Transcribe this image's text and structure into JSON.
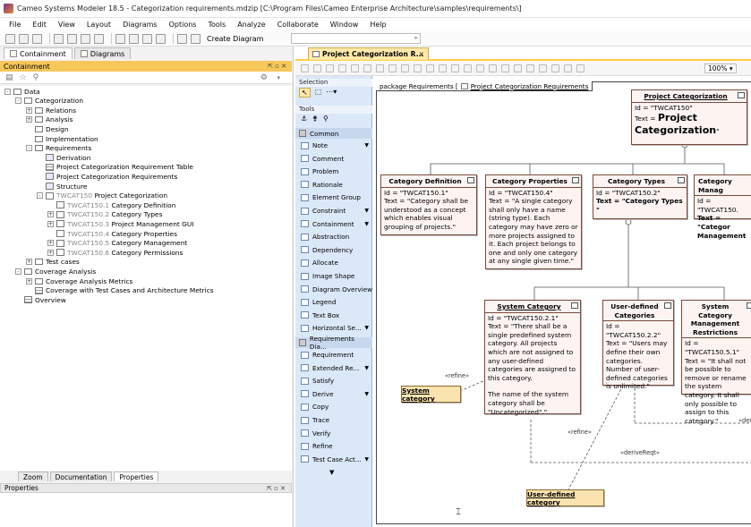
{
  "window": {
    "title": "Cameo Systems Modeler 18.5 - Categorization requirements.mdzip [C:\\Program Files\\Cameo Enterprise Architecture\\samples\\requirements\\]"
  },
  "menu": [
    "File",
    "Edit",
    "View",
    "Layout",
    "Diagrams",
    "Options",
    "Tools",
    "Analyze",
    "Collaborate",
    "Window",
    "Help"
  ],
  "toolbar": {
    "create_diagram": "Create Diagram"
  },
  "left": {
    "tabs": [
      "Containment",
      "Diagrams"
    ],
    "panel_title": "Containment",
    "tree": [
      {
        "label": "Data",
        "depth": 0,
        "expander": "-",
        "icon": "folder"
      },
      {
        "label": "Categorization",
        "depth": 1,
        "expander": "-",
        "icon": "folder"
      },
      {
        "label": "Relations",
        "depth": 2,
        "expander": "+",
        "icon": "folder"
      },
      {
        "label": "Analysis",
        "depth": 2,
        "expander": "+",
        "icon": "folder"
      },
      {
        "label": "Design",
        "depth": 2,
        "expander": "",
        "icon": "folder"
      },
      {
        "label": "Implementation",
        "depth": 2,
        "expander": "",
        "icon": "folder"
      },
      {
        "label": "Requirements",
        "depth": 2,
        "expander": "-",
        "icon": "folder"
      },
      {
        "label": "Derivation",
        "depth": 3,
        "expander": "",
        "icon": "diag"
      },
      {
        "label": "Project Categorization Requirement Table",
        "depth": 3,
        "expander": "",
        "icon": "table"
      },
      {
        "label": "Project Categorization Requirements",
        "depth": 3,
        "expander": "",
        "icon": "diag"
      },
      {
        "label": "Structure",
        "depth": 3,
        "expander": "",
        "icon": "diag"
      },
      {
        "label": "TWCAT150 Project Categorization",
        "depth": 3,
        "expander": "-",
        "icon": "req",
        "gray_prefix": "TWCAT150",
        "rest": " Project Categorization"
      },
      {
        "label": "TWCAT150.1 Category Definition",
        "depth": 4,
        "expander": "",
        "icon": "req",
        "gray_prefix": "TWCAT150.1",
        "rest": " Category Definition"
      },
      {
        "label": "TWCAT150.2 Category Types",
        "depth": 4,
        "expander": "+",
        "icon": "req",
        "gray_prefix": "TWCAT150.2",
        "rest": " Category Types"
      },
      {
        "label": "TWCAT150.3 Project Management GUI",
        "depth": 4,
        "expander": "+",
        "icon": "req",
        "gray_prefix": "TWCAT150.3",
        "rest": " Project Management GUI"
      },
      {
        "label": "TWCAT150.4 Category Properties",
        "depth": 4,
        "expander": "",
        "icon": "req",
        "gray_prefix": "TWCAT150.4",
        "rest": " Category Properties"
      },
      {
        "label": "TWCAT150.5 Category Management",
        "depth": 4,
        "expander": "+",
        "icon": "req",
        "gray_prefix": "TWCAT150.5",
        "rest": " Category Management"
      },
      {
        "label": "TWCAT150.6 Category Permissions",
        "depth": 4,
        "expander": "+",
        "icon": "req",
        "gray_prefix": "TWCAT150.6",
        "rest": " Category Permissions"
      },
      {
        "label": "Test cases",
        "depth": 2,
        "expander": "+",
        "icon": "folder"
      },
      {
        "label": "Coverage Analysis",
        "depth": 1,
        "expander": "-",
        "icon": "folder"
      },
      {
        "label": "Coverage Analysis Metrics",
        "depth": 2,
        "expander": "+",
        "icon": "folder"
      },
      {
        "label": "Coverage with Test Cases and Architecture Metrics",
        "depth": 2,
        "expander": "",
        "icon": "table"
      },
      {
        "label": "Overview",
        "depth": 1,
        "expander": "",
        "icon": "table"
      }
    ],
    "bottom_tabs": [
      "Zoom",
      "Documentation",
      "Properties"
    ],
    "properties_title": "Properties"
  },
  "diagram": {
    "tab_label": "Project Categorization R...",
    "tab_close": "×",
    "zoom": "100%",
    "frame_label": "package  Requirements [",
    "frame_diagram": "Project Categorization Requirements"
  },
  "palette": {
    "selection_header": "Selection",
    "tools_header": "Tools",
    "common_header": "Common",
    "common_items": [
      {
        "label": "Note",
        "dd": true
      },
      {
        "label": "Comment",
        "dd": false
      },
      {
        "label": "Problem",
        "dd": false
      },
      {
        "label": "Rationale",
        "dd": false
      },
      {
        "label": "Element Group",
        "dd": false
      },
      {
        "label": "Constraint",
        "dd": true
      },
      {
        "label": "Containment",
        "dd": true
      },
      {
        "label": "Abstraction",
        "dd": false
      },
      {
        "label": "Dependency",
        "dd": false
      },
      {
        "label": "Allocate",
        "dd": false
      },
      {
        "label": "Image Shape",
        "dd": false
      },
      {
        "label": "Diagram Overview",
        "dd": false
      },
      {
        "label": "Legend",
        "dd": false
      },
      {
        "label": "Text Box",
        "dd": false
      },
      {
        "label": "Horizontal Se...",
        "dd": true
      }
    ],
    "req_header": "Requirements Dia...",
    "req_items": [
      {
        "label": "Requirement",
        "dd": false
      },
      {
        "label": "Extended Re...",
        "dd": true
      },
      {
        "label": "Satisfy",
        "dd": false
      },
      {
        "label": "Derive",
        "dd": true
      },
      {
        "label": "Copy",
        "dd": false
      },
      {
        "label": "Trace",
        "dd": false
      },
      {
        "label": "Verify",
        "dd": false
      },
      {
        "label": "Refine",
        "dd": false
      },
      {
        "label": "Test Case Act...",
        "dd": true
      }
    ]
  },
  "requirements": {
    "root": {
      "name": "Project Categorization",
      "id": "Id = \"TWCAT150\"",
      "text_prefix": "Text = ",
      "text_big": "Project Categorization",
      "text_suffix": "\""
    },
    "def": {
      "name": "Category Definition",
      "id": "Id = \"TWCAT150.1\"",
      "text": "Text = \"Category shall be understood as a concept which enables visual grouping of projects.\""
    },
    "props": {
      "name": "Category Properties",
      "id": "Id = \"TWCAT150.4\"",
      "text": "Text = \"A single category shall only have a name (string type). Each category may have zero or more projects assigned to it. Each project belongs to one and only one category at any single given time.\""
    },
    "types": {
      "name": "Category Types",
      "id": "Id = \"TWCAT150.2\"",
      "text": "Text = \"Category Types \""
    },
    "mgmt": {
      "name": "Category Manag",
      "id": "Id = \"TWCAT150.",
      "text": "Text = \"Categor Management"
    },
    "system": {
      "name": "System Category",
      "id": "Id = \"TWCAT150.2.1\"",
      "text": "Text = \"There shall be a single predefined system category. All projects which are not assigned to any user-defined categories are assigned to this category.",
      "text2": "The name of the system category shall be \"Uncategorized\".\""
    },
    "user": {
      "name": "User-defined Categories",
      "id": "Id = \"TWCAT150.2.2\"",
      "text": "Text = \"Users may define their own categories. Number of user-defined categories is unlimited.\""
    },
    "sysmgmt": {
      "name": "System Category Management Restrictions",
      "id": "Id = \"TWCAT150.5.1\"",
      "text": "Text = \"It shall not be possible to remove or rename the system category. It shall only possible to assign to this category.\""
    }
  },
  "blocks": {
    "system_category": "System category",
    "user_defined_category": "User-defined category"
  },
  "relations": {
    "refine": "«refine»",
    "deriveReqt": "«deriveReqt»",
    "der_cut": "«der"
  }
}
